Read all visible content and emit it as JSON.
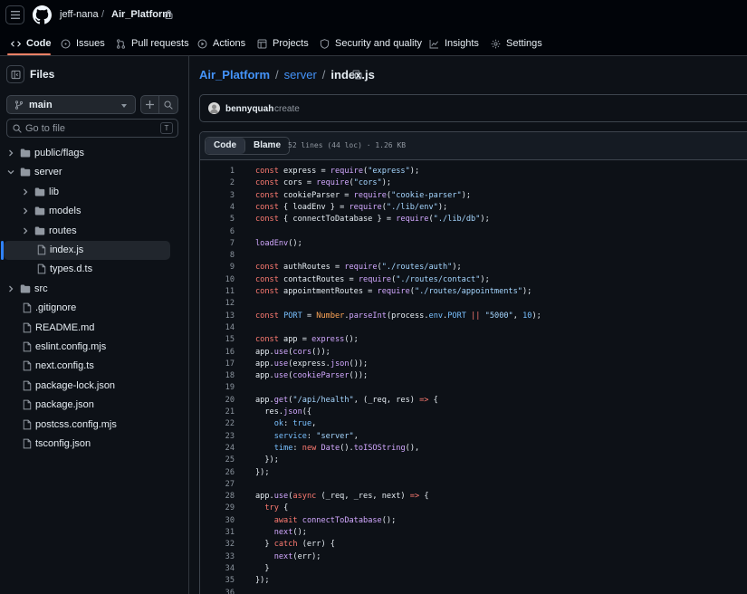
{
  "header": {
    "owner": "jeff-nana",
    "separator": "/",
    "repo": "Air_Platform",
    "nav": [
      {
        "label": "Code",
        "icon": "code-icon"
      },
      {
        "label": "Issues",
        "icon": "issue-opened-icon"
      },
      {
        "label": "Pull requests",
        "icon": "git-pull-request-icon"
      },
      {
        "label": "Actions",
        "icon": "play-icon"
      },
      {
        "label": "Projects",
        "icon": "table-icon"
      },
      {
        "label": "Security and quality",
        "icon": "shield-icon"
      },
      {
        "label": "Insights",
        "icon": "graph-icon"
      },
      {
        "label": "Settings",
        "icon": "gear-icon"
      }
    ]
  },
  "sidebar": {
    "title": "Files",
    "branch": "main",
    "search_placeholder": "Go to file",
    "search_shortcut": "T",
    "tree": [
      {
        "label": "public/flags",
        "type": "folder",
        "expanded": false,
        "depth": 0
      },
      {
        "label": "server",
        "type": "folder",
        "expanded": true,
        "depth": 0
      },
      {
        "label": "lib",
        "type": "folder",
        "expanded": false,
        "depth": 1
      },
      {
        "label": "models",
        "type": "folder",
        "expanded": false,
        "depth": 1
      },
      {
        "label": "routes",
        "type": "folder",
        "expanded": false,
        "depth": 1
      },
      {
        "label": "index.js",
        "type": "file",
        "selected": true,
        "depth": 1
      },
      {
        "label": "types.d.ts",
        "type": "file",
        "depth": 1
      },
      {
        "label": "src",
        "type": "folder",
        "expanded": false,
        "depth": 0
      },
      {
        "label": ".gitignore",
        "type": "file",
        "depth": 0
      },
      {
        "label": "README.md",
        "type": "file",
        "depth": 0
      },
      {
        "label": "eslint.config.mjs",
        "type": "file",
        "depth": 0
      },
      {
        "label": "next.config.ts",
        "type": "file",
        "depth": 0
      },
      {
        "label": "package-lock.json",
        "type": "file",
        "depth": 0
      },
      {
        "label": "package.json",
        "type": "file",
        "depth": 0
      },
      {
        "label": "postcss.config.mjs",
        "type": "file",
        "depth": 0
      },
      {
        "label": "tsconfig.json",
        "type": "file",
        "depth": 0
      }
    ]
  },
  "main": {
    "path": {
      "repo": "Air_Platform",
      "folder": "server",
      "file": "index.js",
      "sep": "/"
    },
    "commit": {
      "author": "bennyquah",
      "message": "create"
    },
    "view_tabs": {
      "code": "Code",
      "blame": "Blame"
    },
    "file_meta": "52 lines (44 loc) · 1.26 KB",
    "code": [
      "const express = require(\"express\");",
      "const cors = require(\"cors\");",
      "const cookieParser = require(\"cookie-parser\");",
      "const { loadEnv } = require(\"./lib/env\");",
      "const { connectToDatabase } = require(\"./lib/db\");",
      "",
      "loadEnv();",
      "",
      "const authRoutes = require(\"./routes/auth\");",
      "const contactRoutes = require(\"./routes/contact\");",
      "const appointmentRoutes = require(\"./routes/appointments\");",
      "",
      "const PORT = Number.parseInt(process.env.PORT || \"5000\", 10);",
      "",
      "const app = express();",
      "app.use(cors());",
      "app.use(express.json());",
      "app.use(cookieParser());",
      "",
      "app.get(\"/api/health\", (_req, res) => {",
      "  res.json({",
      "    ok: true,",
      "    service: \"server\",",
      "    time: new Date().toISOString(),",
      "  });",
      "});",
      "",
      "app.use(async (_req, _res, next) => {",
      "  try {",
      "    await connectToDatabase();",
      "    next();",
      "  } catch (err) {",
      "    next(err);",
      "  }",
      "});",
      ""
    ]
  },
  "colors": {
    "bg": "#0d1117",
    "header_bg": "#010409",
    "border": "#3d444d",
    "link": "#4493f8",
    "accent_underline": "#f78166",
    "keyword": "#ff7b72",
    "string": "#a5d6ff",
    "function": "#d2a8ff",
    "constant": "#79c0ff"
  }
}
